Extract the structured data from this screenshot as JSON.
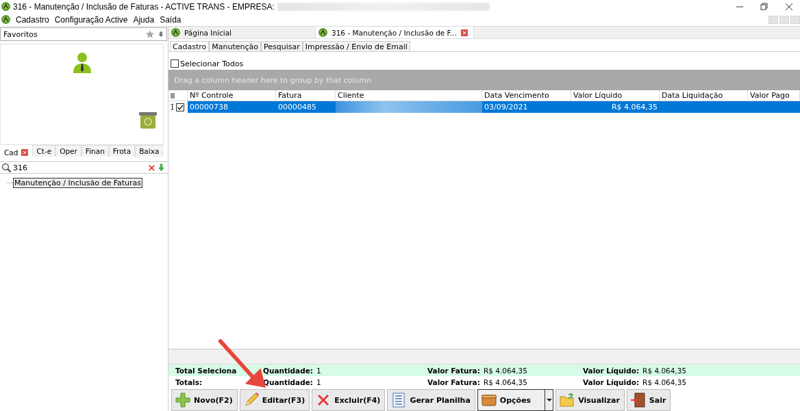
{
  "window": {
    "title": "316 - Manutenção / Inclusão de Faturas - ACTIVE TRANS - EMPRESA:",
    "title_redacted": true
  },
  "menu": [
    "Cadastro",
    "Configuração Active",
    "Ajuda",
    "Saída"
  ],
  "sidebar": {
    "favorites_label": "Favoritos",
    "tabs": [
      {
        "label": "Cad",
        "selected": true,
        "closable": true
      },
      {
        "label": "Ct-e",
        "selected": false,
        "closable": false
      },
      {
        "label": "Oper",
        "selected": false,
        "closable": false
      },
      {
        "label": "Finan",
        "selected": false,
        "closable": false
      },
      {
        "label": "Frota",
        "selected": false,
        "closable": false
      },
      {
        "label": "Baixa",
        "selected": false,
        "closable": false
      }
    ],
    "search": {
      "value": "316"
    },
    "tree": [
      {
        "label": "Manutenção / Inclusão de Faturas",
        "selected": true
      }
    ]
  },
  "doc_tabs": [
    {
      "label": "Página Inicial",
      "selected": false,
      "closable": false
    },
    {
      "label": "316 - Manutenção / Inclusão de F...",
      "selected": true,
      "closable": true
    }
  ],
  "sub_tabs": [
    {
      "label": "Cadastro",
      "selected": true
    },
    {
      "label": "Manutenção",
      "selected": false
    },
    {
      "label": "Pesquisar",
      "selected": false
    },
    {
      "label": "Impressão / Envio de Email",
      "selected": false
    }
  ],
  "select_all": {
    "label": "Selecionar Todos",
    "checked": false
  },
  "group_hint": "Drag a column header here to group by that column",
  "table": {
    "columns": [
      {
        "label": "Nº Controle"
      },
      {
        "label": "Fatura"
      },
      {
        "label": "Cliente"
      },
      {
        "label": "Data Vencimento"
      },
      {
        "label": "Valor Líquido"
      },
      {
        "label": "Data Liquidação"
      },
      {
        "label": "Valor Pago"
      }
    ],
    "rows": [
      {
        "selected": true,
        "checked": true,
        "cells": [
          "00000738",
          "00000485",
          null,
          "03/09/2021",
          "R$ 4.064,35",
          "",
          ""
        ]
      }
    ]
  },
  "totals": [
    {
      "label": "Total Seleciona",
      "highlight": true,
      "items": [
        {
          "label": "Quantidade:",
          "value": "1"
        },
        {
          "label": "Valor Fatura:",
          "value": "R$ 4.064,35"
        },
        {
          "label": "Valor Líquido:",
          "value": "R$ 4.064,35"
        }
      ]
    },
    {
      "label": "Totais:",
      "highlight": false,
      "items": [
        {
          "label": "Quantidade:",
          "value": "1"
        },
        {
          "label": "Valor Fatura:",
          "value": "R$ 4.064,35"
        },
        {
          "label": "Valor Líquido:",
          "value": "R$ 4.064,35"
        }
      ]
    }
  ],
  "buttons": [
    {
      "label": "Novo(F2)",
      "kind": "plus"
    },
    {
      "label": "Editar(F3)",
      "kind": "pencil"
    },
    {
      "label": "Excluir(F4)",
      "kind": "cross"
    },
    {
      "label": "Gerar Planilha",
      "kind": "sheet"
    },
    {
      "label": "Opções",
      "kind": "box"
    },
    {
      "label": "Visualizar",
      "kind": "folder"
    },
    {
      "label": "Sair",
      "kind": "door"
    }
  ],
  "annotation": {
    "kind": "arrow"
  }
}
